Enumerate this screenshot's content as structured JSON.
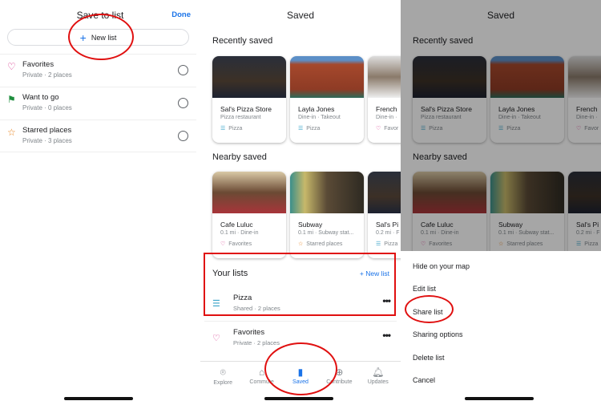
{
  "left": {
    "title": "Save to list",
    "done": "Done",
    "new_list": "New list",
    "lists": [
      {
        "icon": "heart-icon",
        "name": "Favorites",
        "sub": "Private · 2 places"
      },
      {
        "icon": "flag-icon",
        "name": "Want to go",
        "sub": "Private · 0 places"
      },
      {
        "icon": "star-icon",
        "name": "Starred places",
        "sub": "Private · 3 places"
      }
    ]
  },
  "saved": {
    "title": "Saved",
    "recent_heading": "Recently saved",
    "nearby_heading": "Nearby saved",
    "recent": [
      {
        "name": "Sal's Pizza Store",
        "sub": "Pizza restaurant",
        "tag": "Pizza"
      },
      {
        "name": "Layla Jones",
        "sub": "Dine-in · Takeout",
        "tag": "Pizza"
      },
      {
        "name": "French",
        "sub": "Dine-in ·",
        "tag": "Favor"
      }
    ],
    "nearby": [
      {
        "name": "Cafe Luluc",
        "sub": "0.1 mi · Dine-in",
        "tag": "Favorites"
      },
      {
        "name": "Subway",
        "sub": "0.1 mi · Subway stat...",
        "tag": "Starred places"
      },
      {
        "name": "Sal's Pi",
        "sub": "0.2 mi · F",
        "tag": "Pizza"
      }
    ],
    "your_lists": "Your lists",
    "new_list": "New list",
    "lists": [
      {
        "name": "Pizza",
        "sub": "Shared · 2 places"
      },
      {
        "name": "Favorites",
        "sub": "Private · 2 places"
      }
    ],
    "nav": [
      "Explore",
      "Commute",
      "Saved",
      "Contribute",
      "Updates"
    ],
    "active_nav": "Saved"
  },
  "menu": [
    "Hide on your map",
    "Edit list",
    "Share list",
    "Sharing options",
    "Delete list",
    "Cancel"
  ],
  "colors": {
    "accent": "#1a73e8",
    "annotation": "#e01010"
  }
}
